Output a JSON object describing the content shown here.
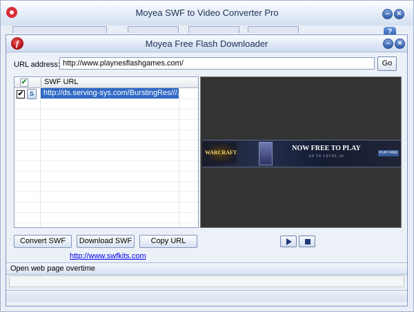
{
  "back_window": {
    "title": "Moyea SWF to Video Converter Pro",
    "help_label": "?"
  },
  "dialog": {
    "title": "Moyea Free Flash Downloader",
    "logo_letter": "f",
    "url_label": "URL address:",
    "url_value": "http://www.playnesflashgames.com/",
    "go_label": "Go",
    "list": {
      "header_check": "✔",
      "column_header": "SWF URL",
      "rows": [
        {
          "checked": "✔",
          "url": "http://ds.serving-sys.com/BurstingRes///..."
        }
      ]
    },
    "preview": {
      "banner_logo": "WARCRAFT",
      "banner_main": "NOW FREE TO PLAY",
      "banner_sub": "UP TO LEVEL 20",
      "banner_button": "PLAY FREE"
    },
    "buttons": {
      "convert": "Convert SWF",
      "download": "Download SWF",
      "copy_url": "Copy URL"
    },
    "link": "http://www.swfkits.com",
    "status": "Open web page overtime"
  },
  "colors": {
    "selection": "#316ac5",
    "preview_bg": "#333333",
    "link": "#0000ee"
  }
}
